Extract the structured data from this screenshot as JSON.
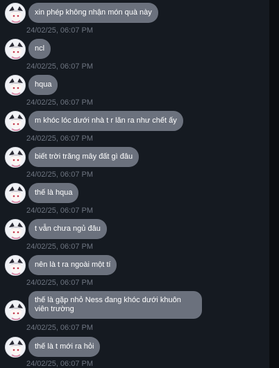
{
  "messages": [
    {
      "text": "xin phép không nhận món quà này",
      "time": "24/02/25, 06:07 PM"
    },
    {
      "text": "ncl",
      "time": "24/02/25, 06:07 PM"
    },
    {
      "text": "hqua",
      "time": "24/02/25, 06:07 PM"
    },
    {
      "text": "m khóc lóc dưới nhà t r lăn ra như chết ấy",
      "time": "24/02/25, 06:07 PM"
    },
    {
      "text": "biết trời trăng mây đất gì đâu",
      "time": "24/02/25, 06:07 PM"
    },
    {
      "text": "thế là hqua",
      "time": "24/02/25, 06:07 PM"
    },
    {
      "text": "t vẫn chưa ngủ đâu",
      "time": "24/02/25, 06:07 PM"
    },
    {
      "text": "nên là t ra ngoài một tí",
      "time": "24/02/25, 06:07 PM"
    },
    {
      "text": "thế là gặp nhỏ Ness đang khóc dưới khuôn viên trường",
      "time": "24/02/25, 06:07 PM"
    },
    {
      "text": "thế là t mới ra hỏi",
      "time": "24/02/25, 06:07 PM"
    }
  ],
  "avatar_icon": "user-avatar-icon",
  "colors": {
    "background": "#151a21",
    "bubble": "#6b717d",
    "timestamp": "#6e7581"
  }
}
